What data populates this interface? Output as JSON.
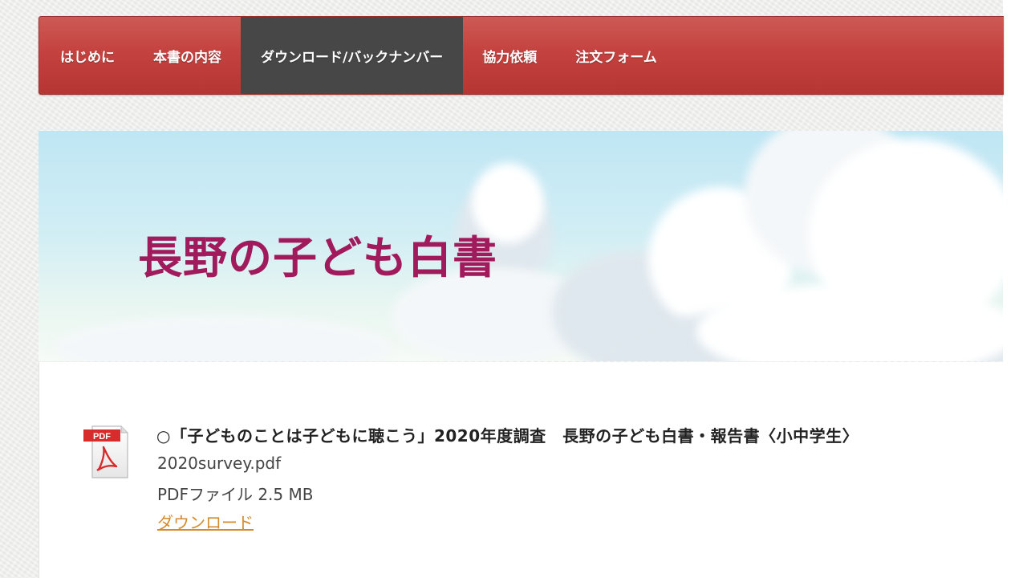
{
  "nav": {
    "items": [
      {
        "label": "はじめに",
        "active": false
      },
      {
        "label": "本書の内容",
        "active": false
      },
      {
        "label": "ダウンロード/バックナンバー",
        "active": true
      },
      {
        "label": "協力依頼",
        "active": false
      },
      {
        "label": "注文フォーム",
        "active": false
      }
    ]
  },
  "banner": {
    "title": "長野の子ども白書"
  },
  "document": {
    "icon": "pdf-file-icon",
    "icon_label": "PDF",
    "title": "○「子どものことは子どもに聴こう」2020年度調査　長野の子ども白書・報告書〈小中学生〉",
    "filename": "2020survey.pdf",
    "filesize": "PDFファイル 2.5 MB",
    "download_label": "ダウンロード"
  },
  "colors": {
    "nav_red": "#c4423f",
    "nav_active": "#474747",
    "title_magenta": "#a01a5c",
    "link_orange": "#d58a2c"
  }
}
